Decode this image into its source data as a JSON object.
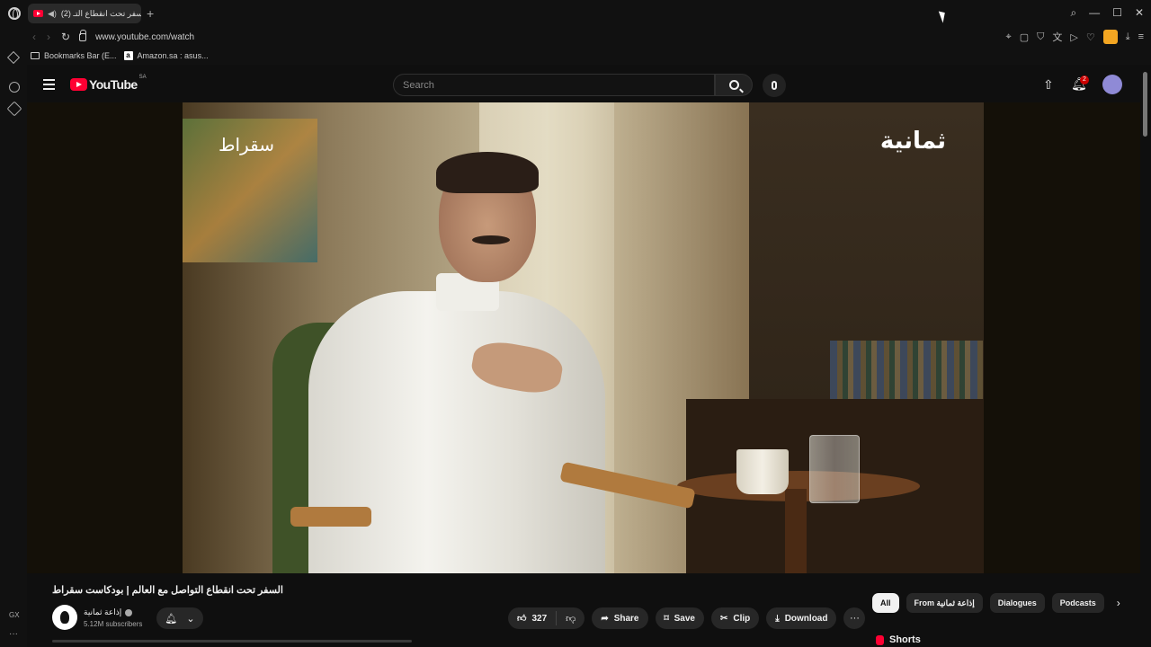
{
  "browser": {
    "tab_title": "(2) السفر تحت انقطاع التـ",
    "url": "www.youtube.com/watch",
    "bookmarks": [
      {
        "label": "Bookmarks Bar (E..."
      },
      {
        "label": "Amazon.sa : asus..."
      }
    ],
    "sidebar_gx": "GX"
  },
  "youtube": {
    "logo_text": "YouTube",
    "country_code": "SA",
    "search_placeholder": "Search",
    "notification_count": "2"
  },
  "video": {
    "overlay_left": "سقراط",
    "overlay_right": "ثمانية",
    "title": "السفر تحت انقطاع التواصل مع العالم | بودكاست سقراط",
    "channel_name": "إذاعة ثمانية",
    "subscribers": "5.12M subscribers",
    "like_count": "327",
    "share_label": "Share",
    "save_label": "Save",
    "clip_label": "Clip",
    "download_label": "Download"
  },
  "chips": [
    {
      "label": "All",
      "active": true
    },
    {
      "label": "From إذاعة ثمانية"
    },
    {
      "label": "Dialogues"
    },
    {
      "label": "Podcasts"
    }
  ],
  "shorts_label": "Shorts",
  "colors": {
    "brand_red": "#ff0033",
    "background": "#0f0f0f",
    "pill": "#272727"
  }
}
